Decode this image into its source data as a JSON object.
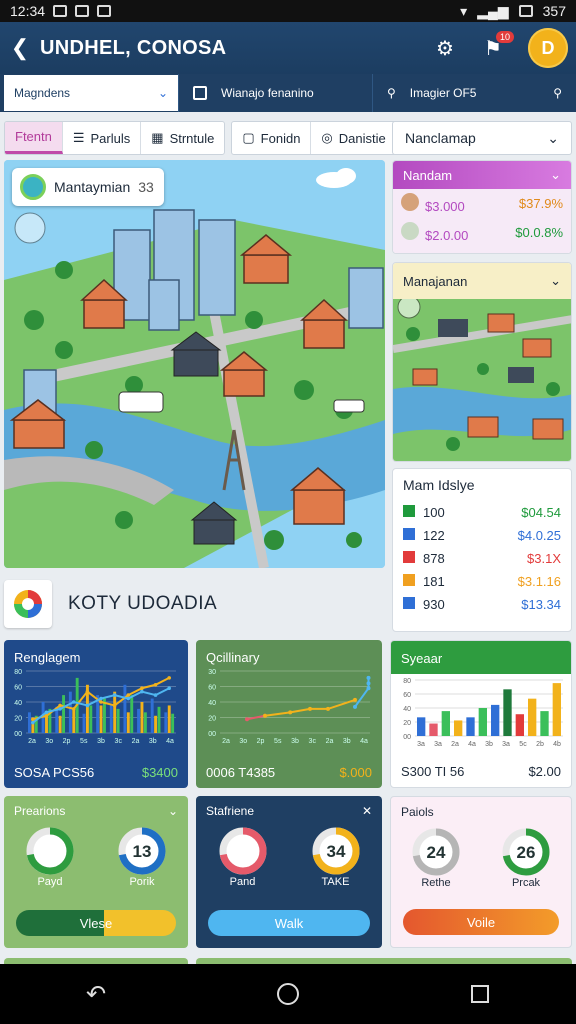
{
  "status_bar": {
    "time": "12:34",
    "battery": "357"
  },
  "header": {
    "title": "UNDHEL, CONOSA",
    "notif_badge": "10",
    "coin_label": "D"
  },
  "toolbar": {
    "select_value": "Magndens",
    "segment2_label": "Wianajo fenanino",
    "segment3_label": "Imagier OF5"
  },
  "tabs": [
    {
      "label": "Ftentn"
    },
    {
      "label": "Parluls"
    },
    {
      "label": "Strntule"
    },
    {
      "label": "Fonidn"
    },
    {
      "label": "Danistie"
    }
  ],
  "right_dropdown": {
    "label": "Nanclamap"
  },
  "map": {
    "label": "Mantaymian",
    "count": "33"
  },
  "panel1": {
    "title": "Nandam",
    "rows": [
      {
        "left": "$3.000",
        "right": "$37.9%"
      },
      {
        "left": "$2.0.00",
        "right": "$0.0.8%"
      }
    ]
  },
  "panel2": {
    "title": "Manajanan"
  },
  "panel3": {
    "title": "Mam Idslye",
    "rows": [
      {
        "label": "100",
        "value": "$04.54",
        "color": "#1f9a3c"
      },
      {
        "label": "122",
        "value": "$4.0.25",
        "color": "#2f6fd6"
      },
      {
        "label": "878",
        "value": "$3.1X",
        "color": "#e23b3b"
      },
      {
        "label": "181",
        "value": "$3.1.16",
        "color": "#f0a020"
      },
      {
        "label": "930",
        "value": "$13.34",
        "color": "#2f6fd6"
      }
    ]
  },
  "section": {
    "title": "KOTY UDOADIA"
  },
  "charts": [
    {
      "title": "Renglagem",
      "footer_left": "SOSA PCS56",
      "footer_right": "$3400",
      "chart_data": {
        "type": "bar",
        "y_ticks": [
          "80",
          "60",
          "40",
          "20",
          "00"
        ],
        "x_ticks": [
          "2a",
          "3o",
          "2p",
          "5s",
          "3b",
          "3c",
          "2a",
          "3b",
          "4a"
        ],
        "series": [
          {
            "color": "#2f6fd6",
            "values": [
              30,
              45,
              38,
              60,
              28,
              55,
              42,
              70,
              35,
              50,
              30
            ]
          },
          {
            "color": "#f2b21b",
            "values": [
              20,
              30,
              25,
              35,
              70,
              40,
              60,
              30,
              45,
              25,
              40
            ]
          },
          {
            "color": "#3bbf5a",
            "values": [
              25,
              35,
              55,
              80,
              40,
              50,
              35,
              55,
              30,
              38,
              28
            ]
          }
        ],
        "lines": [
          {
            "color": "#f2b21b",
            "values": [
              20,
              25,
              40,
              35,
              60,
              45,
              40,
              55,
              65,
              70,
              80
            ]
          },
          {
            "color": "#4fb6f0",
            "values": [
              15,
              30,
              35,
              45,
              40,
              50,
              55,
              50,
              60,
              55,
              65
            ]
          }
        ],
        "ylim": [
          0,
          90
        ]
      }
    },
    {
      "title": "Qcillinary",
      "footer_left": "0006 T4385",
      "footer_right": "$.000",
      "chart_data": {
        "type": "line",
        "y_ticks": [
          "30",
          "60",
          "40",
          "20",
          "00"
        ],
        "x_ticks": [
          "2a",
          "3o",
          "2p",
          "5s",
          "3b",
          "3c",
          "2a",
          "3b",
          "4a"
        ],
        "series": [
          {
            "color": "#e55a6a",
            "values": [
              20,
              25
            ]
          },
          {
            "color": "#f2b21b",
            "values": [
              25,
              30,
              35,
              35,
              48
            ]
          },
          {
            "color": "#4fb6f0",
            "values": [
              38,
              65,
              72,
              80
            ]
          }
        ],
        "ylim": [
          0,
          90
        ]
      }
    },
    {
      "title": "Syeaar",
      "footer_left": "S300 TI 56",
      "footer_right": "$2.00",
      "chart_data": {
        "type": "bar",
        "y_ticks": [
          "80",
          "60",
          "40",
          "20",
          "00"
        ],
        "x_ticks": [
          "3a",
          "3a",
          "2a",
          "4a",
          "3b",
          "3a",
          "5c",
          "2b",
          "4b"
        ],
        "colors": [
          "#2f6fd6",
          "#e55a6a",
          "#3bbf5a",
          "#f2b21b",
          "#2f6fd6",
          "#3bbf5a",
          "#2f6fd6",
          "#1f7a3c",
          "#e23b3b",
          "#f2b21b",
          "#3bbf5a",
          "#f2b21b"
        ],
        "values": [
          30,
          20,
          40,
          25,
          30,
          45,
          50,
          75,
          35,
          60,
          40,
          85
        ],
        "ylim": [
          0,
          90
        ]
      }
    }
  ],
  "gauges_cards": [
    {
      "title": "Prearions",
      "gauges": [
        {
          "value": "",
          "label": "Payd",
          "color": "#2e9c3f"
        },
        {
          "value": "13",
          "label": "Porik",
          "color": "#1f6fc4"
        }
      ],
      "button": "Vlese"
    },
    {
      "title": "Stafriene",
      "gauges": [
        {
          "value": "",
          "label": "Pand",
          "color": "#e55a6a"
        },
        {
          "value": "34",
          "label": "TAKE",
          "color": "#f2b21b"
        }
      ],
      "button": "Walk"
    },
    {
      "title": "Paiols",
      "gauges": [
        {
          "value": "24",
          "label": "Rethe",
          "color": "#b5b5b5"
        },
        {
          "value": "26",
          "label": "Prcak",
          "color": "#2e9c3f"
        }
      ],
      "button": "Voile"
    }
  ]
}
